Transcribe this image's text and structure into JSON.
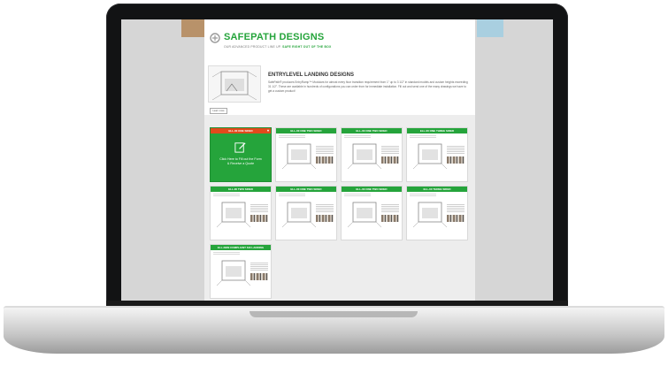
{
  "brand": {
    "name": "SAFEPATH DESIGNS",
    "tagline_start": "OUR ADVANCED PRODUCT LINE UP.",
    "tagline_accent": "SAFE RIGHT OUT OF THE BOX"
  },
  "hero": {
    "title": "ENTRYLEVEL LANDING DESIGNS",
    "text": "SafePath® produces EntryRamp™ Modulars for almost every floor transition requirement from 1\" up to 3 1/2\" in standard models and custom heights exceeding 31 1/2\". These are available in hundreds of configurations you can order from for immediate installation. Fill out and send one of the many drawings we have to get a custom product!",
    "button_label": "Learn more"
  },
  "cta": {
    "title": "ELL-00 ONE SIDED",
    "close": "▾",
    "line1": "Click Here to Fill out the Form",
    "line2": "& Receive a Quote"
  },
  "cards": [
    {
      "title": "ELL-00 ONE TWO SIDED"
    },
    {
      "title": "ELL-00 ONE TWO SIDED"
    },
    {
      "title": "ELL-00 ONE THREE SIDED"
    },
    {
      "title": "ELL-00 TWO SIDED"
    },
    {
      "title": "ELL-00 ONE TWO SIDED"
    },
    {
      "title": "ELL-00 ONE TWO SIDED"
    },
    {
      "title": "ELL-00 THREE SIDED"
    },
    {
      "title": "ELL-NON COMPLIANT SIX LANDING"
    }
  ],
  "colors": {
    "brand_green": "#25a43b",
    "cta_header": "#e24a1c"
  }
}
